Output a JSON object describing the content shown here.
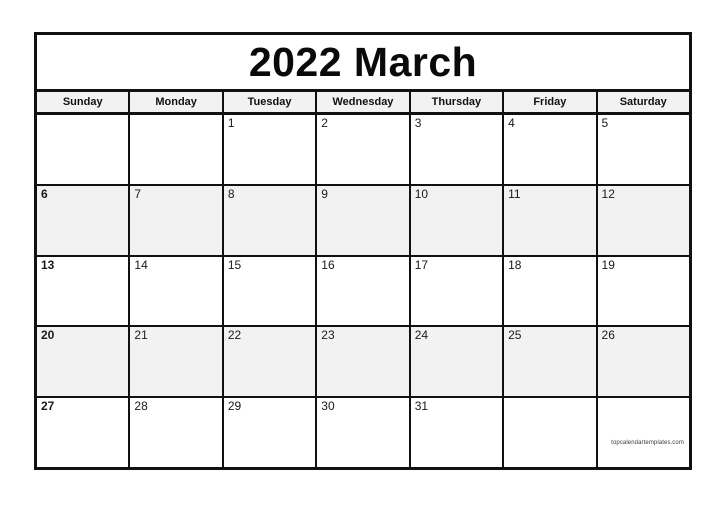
{
  "document": {
    "type": "monthly-calendar",
    "title": "2022 March",
    "year": "2022",
    "month": "March"
  },
  "colors": {
    "page_background": "#ffffff",
    "border": "#111111",
    "header_cell_background": "#f2f2f2",
    "shaded_row_background": "#f2f2f2",
    "text": "#111111"
  },
  "weekdays": [
    {
      "label": "Sunday"
    },
    {
      "label": "Monday"
    },
    {
      "label": "Tuesday"
    },
    {
      "label": "Wednesday"
    },
    {
      "label": "Thursday"
    },
    {
      "label": "Friday"
    },
    {
      "label": "Saturday"
    }
  ],
  "weeks": [
    {
      "shaded": false,
      "days": [
        {
          "num": ""
        },
        {
          "num": ""
        },
        {
          "num": "1"
        },
        {
          "num": "2"
        },
        {
          "num": "3"
        },
        {
          "num": "4"
        },
        {
          "num": "5"
        }
      ]
    },
    {
      "shaded": true,
      "days": [
        {
          "num": "6"
        },
        {
          "num": "7"
        },
        {
          "num": "8"
        },
        {
          "num": "9"
        },
        {
          "num": "10"
        },
        {
          "num": "11"
        },
        {
          "num": "12"
        }
      ]
    },
    {
      "shaded": false,
      "days": [
        {
          "num": "13"
        },
        {
          "num": "14"
        },
        {
          "num": "15"
        },
        {
          "num": "16"
        },
        {
          "num": "17"
        },
        {
          "num": "18"
        },
        {
          "num": "19"
        }
      ]
    },
    {
      "shaded": true,
      "days": [
        {
          "num": "20"
        },
        {
          "num": "21"
        },
        {
          "num": "22"
        },
        {
          "num": "23"
        },
        {
          "num": "24"
        },
        {
          "num": "25"
        },
        {
          "num": "26"
        }
      ]
    },
    {
      "shaded": false,
      "days": [
        {
          "num": "27"
        },
        {
          "num": "28"
        },
        {
          "num": "29"
        },
        {
          "num": "30"
        },
        {
          "num": "31"
        },
        {
          "num": ""
        },
        {
          "num": ""
        }
      ]
    }
  ],
  "watermark": {
    "text": "topcalendartemplates.com",
    "week_index": 4,
    "day_index": 6
  }
}
